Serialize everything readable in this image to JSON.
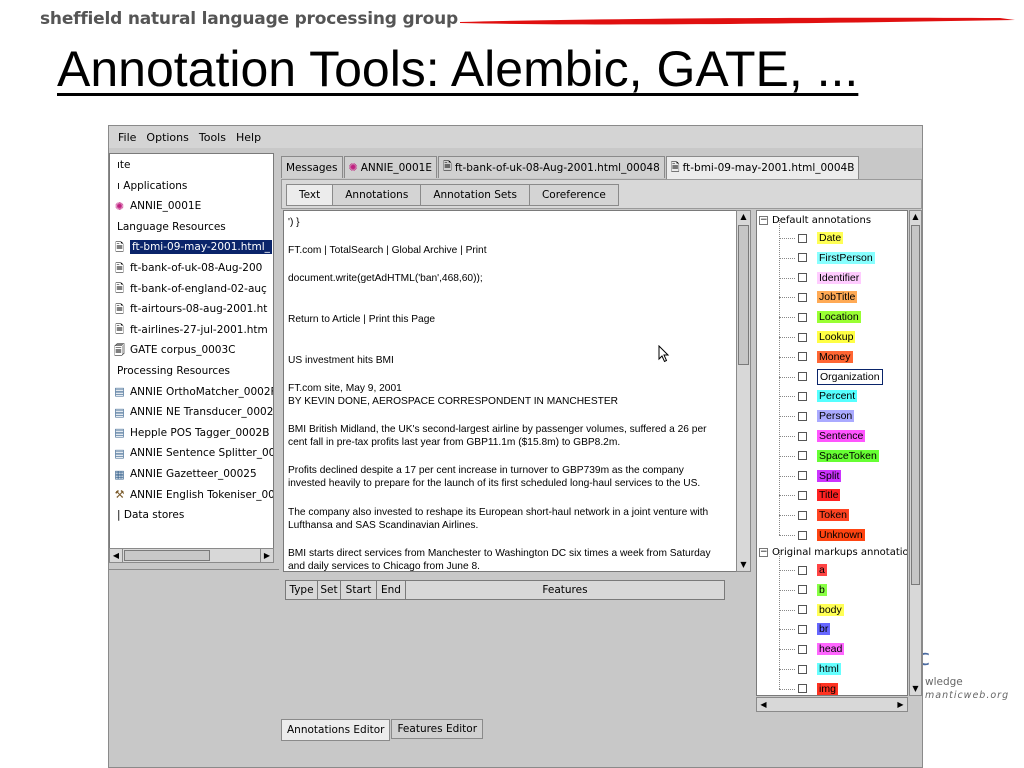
{
  "slide": {
    "group_name": "sheffield natural language processing group",
    "title": "Annotation Tools: Alembic, GATE, ..."
  },
  "menu": [
    "File",
    "Options",
    "Tools",
    "Help"
  ],
  "resources_tree": [
    {
      "label": "ıte",
      "icon": "none"
    },
    {
      "label": "ı Applications",
      "icon": "none"
    },
    {
      "label": "ANNIE_0001E",
      "icon": "annie-app-icon"
    },
    {
      "label": "Language Resources",
      "icon": "none"
    },
    {
      "label": "ft-bmi-09-may-2001.html_",
      "icon": "document-icon",
      "selected": true
    },
    {
      "label": "ft-bank-of-uk-08-Aug-200",
      "icon": "document-icon"
    },
    {
      "label": "ft-bank-of-england-02-auç",
      "icon": "document-icon"
    },
    {
      "label": "ft-airtours-08-aug-2001.ht",
      "icon": "document-icon"
    },
    {
      "label": "ft-airlines-27-jul-2001.htm",
      "icon": "document-icon"
    },
    {
      "label": "GATE corpus_0003C",
      "icon": "corpus-icon"
    },
    {
      "label": "Processing Resources",
      "icon": "none"
    },
    {
      "label": "ANNIE OrthoMatcher_0002F",
      "icon": "pr-icon"
    },
    {
      "label": "ANNIE NE Transducer_0002",
      "icon": "pr-icon"
    },
    {
      "label": "Hepple POS Tagger_0002B",
      "icon": "pr-icon"
    },
    {
      "label": "ANNIE Sentence Splitter_000",
      "icon": "pr-icon"
    },
    {
      "label": "ANNIE Gazetteer_00025",
      "icon": "gazetteer-icon"
    },
    {
      "label": "ANNIE English Tokeniser_00",
      "icon": "tokeniser-icon"
    },
    {
      "label": "| Data stores",
      "icon": "none"
    }
  ],
  "doc_tabs": [
    {
      "label": "Messages",
      "icon": "none"
    },
    {
      "label": "ANNIE_0001E",
      "icon": "annie-app-icon"
    },
    {
      "label": "ft-bank-of-uk-08-Aug-2001.html_00048",
      "icon": "document-icon"
    },
    {
      "label": "ft-bmi-09-may-2001.html_0004B",
      "icon": "document-icon",
      "active": true
    }
  ],
  "view_tabs": [
    {
      "label": "Text",
      "active": true
    },
    {
      "label": "Annotations"
    },
    {
      "label": "Annotation Sets"
    },
    {
      "label": "Coreference"
    }
  ],
  "document_text": [
    "') }",
    "FT.com | TotalSearch | Global Archive | Print",
    "document.write(getAdHTML('ban',468,60));",
    "Return to Article | Print this Page",
    "US investment hits BMI",
    "FT.com site, May 9, 2001",
    "BY KEVIN DONE, AEROSPACE CORRESPONDENT IN MANCHESTER",
    "BMI British Midland, the UK's second-largest airline by passenger volumes, suffered a 26 per",
    "cent fall in pre-tax profits last year from GBP11.1m ($15.8m) to GBP8.2m.",
    "Profits declined despite a 17 per cent increase in turnover to GBP739m as the company",
    "invested heavily to prepare for the launch of its first scheduled long-haul services to the US.",
    "The company also invested to reshape its European short-haul network in a joint venture with",
    "Lufthansa and SAS Scandinavian Airlines.",
    "BMI starts direct services from Manchester to Washington DC six times a week from Saturday",
    "and daily services to Chicago from June 8."
  ],
  "annotation_table_columns": [
    "Type",
    "Set",
    "Start",
    "End",
    "Features"
  ],
  "editor_tabs": [
    {
      "label": "Annotations Editor",
      "active": true
    },
    {
      "label": "Features Editor"
    }
  ],
  "annotation_sets": {
    "default_label": "Default annotations",
    "default_types": [
      {
        "name": "Date",
        "color": "#ffff55"
      },
      {
        "name": "FirstPerson",
        "color": "#88ffff"
      },
      {
        "name": "Identifier",
        "color": "#ffccff"
      },
      {
        "name": "JobTitle",
        "color": "#ffaa55"
      },
      {
        "name": "Location",
        "color": "#99ff33"
      },
      {
        "name": "Lookup",
        "color": "#ffff44"
      },
      {
        "name": "Money",
        "color": "#ff6633"
      },
      {
        "name": "Organization",
        "color": "#ffffff",
        "outlined": true
      },
      {
        "name": "Percent",
        "color": "#55ffff"
      },
      {
        "name": "Person",
        "color": "#aaaaff"
      },
      {
        "name": "Sentence",
        "color": "#ff55ff"
      },
      {
        "name": "SpaceToken",
        "color": "#66ff33"
      },
      {
        "name": "Split",
        "color": "#cc33ff"
      },
      {
        "name": "Title",
        "color": "#ff2222"
      },
      {
        "name": "Token",
        "color": "#ff4422"
      },
      {
        "name": "Unknown",
        "color": "#ff4411"
      }
    ],
    "original_label": "Original markups annotatio",
    "original_types": [
      {
        "name": "a",
        "color": "#ff4444"
      },
      {
        "name": "b",
        "color": "#88ff44"
      },
      {
        "name": "body",
        "color": "#ffff55"
      },
      {
        "name": "br",
        "color": "#6666ff"
      },
      {
        "name": "head",
        "color": "#ff66ff"
      },
      {
        "name": "html",
        "color": "#66ffff"
      },
      {
        "name": "img",
        "color": "#ff3322"
      }
    ]
  },
  "background_fragments": {
    "knowledge": "wledge",
    "site": "manticweb.org"
  }
}
